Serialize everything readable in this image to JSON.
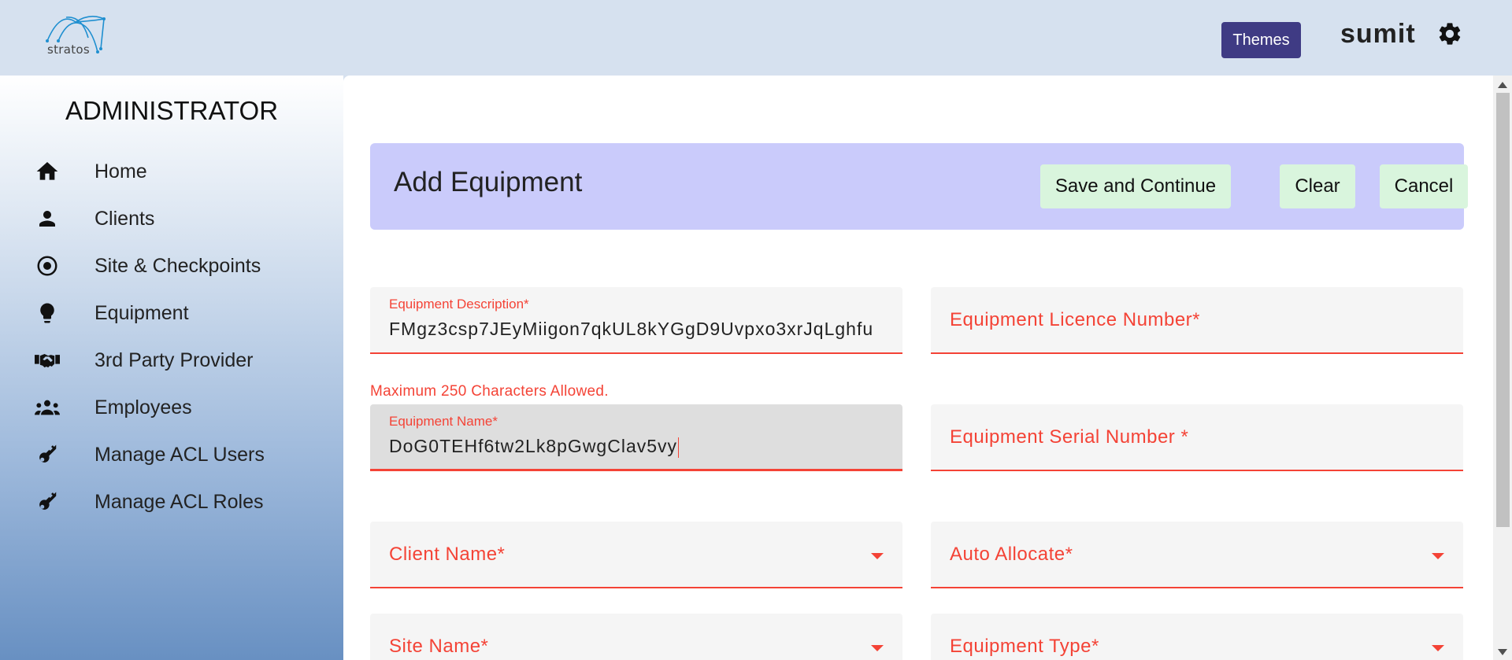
{
  "header": {
    "logo_text": "stratos",
    "themes_label": "Themes",
    "username": "sumit"
  },
  "sidebar": {
    "title": "ADMINISTRATOR",
    "items": [
      {
        "label": "Home",
        "icon": "home-icon"
      },
      {
        "label": "Clients",
        "icon": "person-icon"
      },
      {
        "label": "Site & Checkpoints",
        "icon": "target-icon"
      },
      {
        "label": "Equipment",
        "icon": "lightbulb-icon"
      },
      {
        "label": "3rd Party Provider",
        "icon": "handshake-icon"
      },
      {
        "label": "Employees",
        "icon": "group-icon"
      },
      {
        "label": "Manage ACL Users",
        "icon": "key-icon"
      },
      {
        "label": "Manage ACL Roles",
        "icon": "key-icon"
      }
    ]
  },
  "form": {
    "title": "Add Equipment",
    "save_label": "Save and Continue",
    "clear_label": "Clear",
    "cancel_label": "Cancel",
    "equipment_description": {
      "label": "Equipment Description*",
      "value": "FMgz3csp7JEyMiigon7qkUL8kYGgD9Uvpxo3xrJqLghfu"
    },
    "equipment_licence_number": {
      "label": "Equipment Licence Number*"
    },
    "error_message": "Maximum 250 Characters Allowed.",
    "equipment_name": {
      "label": "Equipment Name*",
      "value": "DoG0TEHf6tw2Lk8pGwgClav5vy"
    },
    "equipment_serial_number": {
      "label": "Equipment Serial Number *"
    },
    "client_name": {
      "label": "Client Name*"
    },
    "auto_allocate": {
      "label": "Auto Allocate*"
    },
    "site_name": {
      "label": "Site Name*"
    },
    "equipment_type": {
      "label": "Equipment Type*"
    }
  },
  "colors": {
    "accent_error": "#f44336",
    "header_card": "#cacbfb",
    "button_bg": "#d9f5dd",
    "themes_button": "#3f3b84"
  }
}
